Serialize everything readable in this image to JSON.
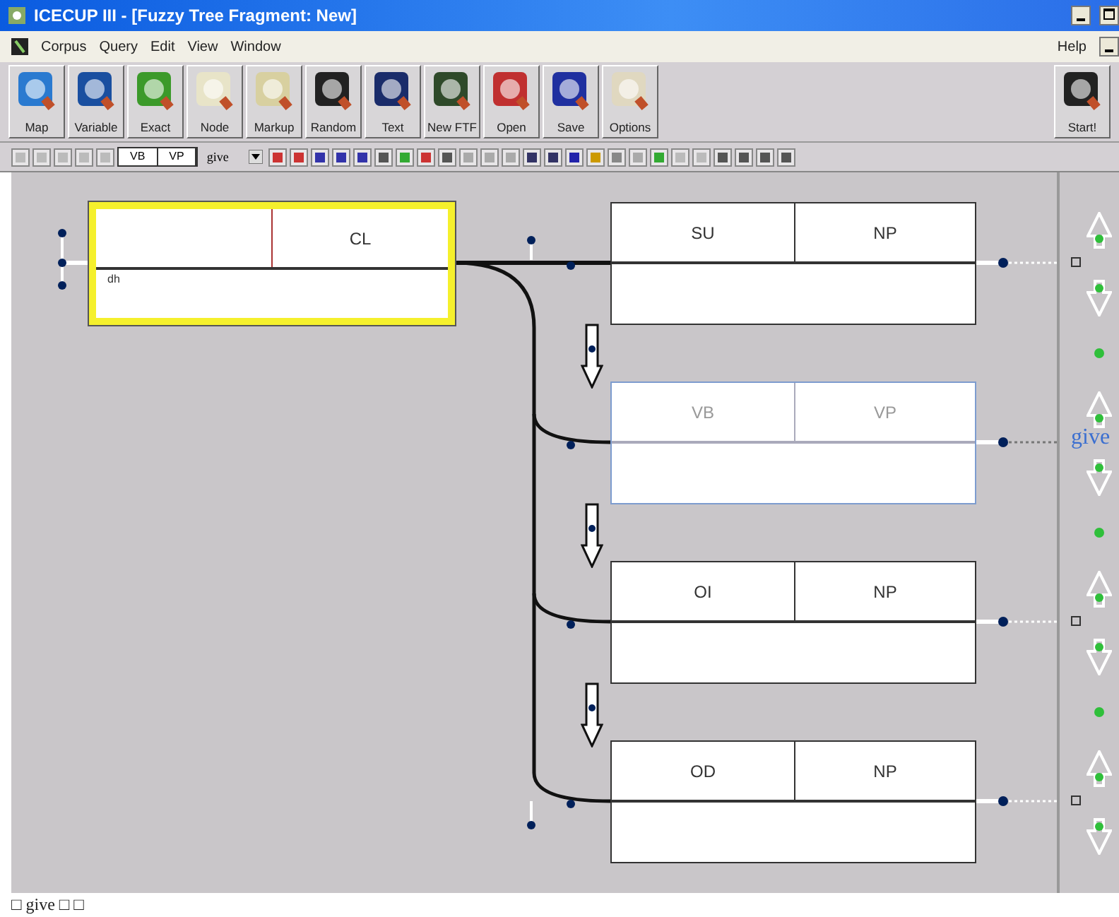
{
  "window": {
    "title": "ICECUP III - [Fuzzy Tree Fragment: New]"
  },
  "menu": {
    "items": [
      "Corpus",
      "Query",
      "Edit",
      "View",
      "Window"
    ],
    "help": "Help"
  },
  "toolbar": {
    "buttons": [
      "Map",
      "Variable",
      "Exact",
      "Node",
      "Markup",
      "Random",
      "Text",
      "New FTF",
      "Open",
      "Save",
      "Options"
    ],
    "start": "Start!"
  },
  "query_bar": {
    "fields": [
      "VB",
      "VP"
    ],
    "word": "give"
  },
  "nodes": [
    {
      "category": "CL",
      "note": "dh",
      "selected": true,
      "lexical": false,
      "arrow_above": false
    },
    {
      "function": "SU",
      "category": "NP",
      "selected": false,
      "lexical": false,
      "arrow_above": false
    },
    {
      "function": "VB",
      "category": "VP",
      "selected": false,
      "lexical": true,
      "arrow_above": true,
      "word": "give"
    },
    {
      "function": "OI",
      "category": "NP",
      "selected": false,
      "lexical": false,
      "arrow_above": true
    },
    {
      "function": "OD",
      "category": "NP",
      "selected": false,
      "lexical": false,
      "arrow_above": true
    }
  ],
  "status": "□ give □ □"
}
